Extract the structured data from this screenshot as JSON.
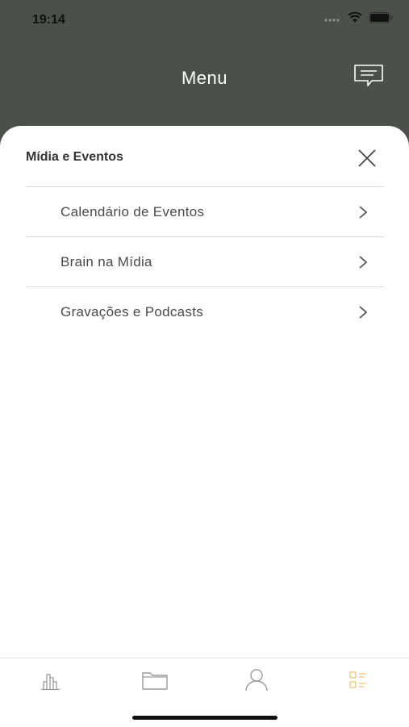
{
  "status_bar": {
    "time": "19:14"
  },
  "header": {
    "title": "Menu"
  },
  "sheet": {
    "title": "Mídia e Eventos",
    "items": [
      {
        "label": "Calendário de Eventos"
      },
      {
        "label": "Brain na Mídia"
      },
      {
        "label": "Gravações e Podcasts"
      }
    ]
  },
  "tab_bar": {
    "tabs": [
      {
        "icon": "bar-chart-icon"
      },
      {
        "icon": "folder-icon"
      },
      {
        "icon": "user-icon"
      },
      {
        "icon": "menu-list-icon",
        "active": true
      }
    ],
    "active_color": "#e8c27a",
    "inactive_color": "#9a9a9a"
  },
  "colors": {
    "header_bg": "#4b514a",
    "sheet_bg": "#ffffff"
  }
}
